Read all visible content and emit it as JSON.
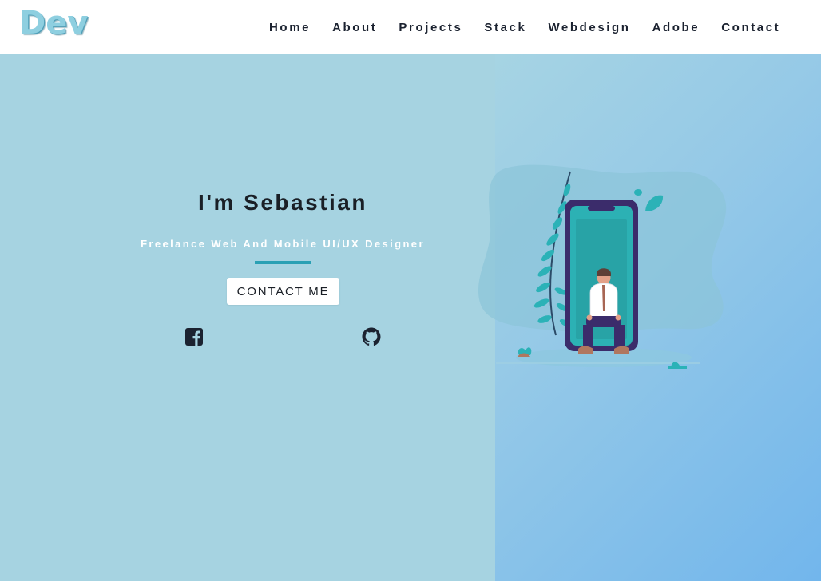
{
  "header": {
    "logo": "Dev",
    "nav": [
      "Home",
      "About",
      "Projects",
      "Stack",
      "Webdesign",
      "Adobe",
      "Contact"
    ]
  },
  "hero": {
    "title": "I'm Sebastian",
    "subtitle": "Freelance Web And Mobile UI/UX Designer",
    "cta_label": "CONTACT ME"
  },
  "social": [
    {
      "icon": "facebook-square-icon"
    },
    {
      "icon": "github-icon"
    }
  ],
  "illustration": {
    "icon": "person-sitting-on-phone-illustration"
  },
  "colors": {
    "nav_bg": "#ffffff",
    "left_bg": "#a6d3e1",
    "right_gradient_end": "#72b6ec",
    "accent": "#2aa0b4",
    "text_dark": "#1a1f26"
  }
}
